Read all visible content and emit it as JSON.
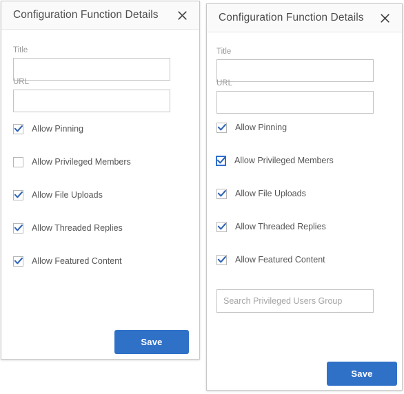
{
  "background_color": "#ffffff",
  "accent_color": "#3071c8",
  "panels": [
    {
      "id": "left",
      "header": {
        "title": "Configuration Function Details",
        "close_icon": "close-x-icon"
      },
      "fields": {
        "title": {
          "label": "Title",
          "value": "",
          "placeholder": ""
        },
        "url": {
          "label": "URL",
          "value": "",
          "placeholder": ""
        }
      },
      "checkboxes": [
        {
          "label": "Allow Pinning",
          "checked": true,
          "focused": false
        },
        {
          "label": "Allow Privileged Members",
          "checked": false,
          "focused": false
        },
        {
          "label": "Allow File Uploads",
          "checked": true,
          "focused": false
        },
        {
          "label": "Allow Threaded Replies",
          "checked": true,
          "focused": false
        },
        {
          "label": "Allow Featured Content",
          "checked": true,
          "focused": false
        }
      ],
      "search": null,
      "save_label": "Save"
    },
    {
      "id": "right",
      "header": {
        "title": "Configuration Function Details",
        "close_icon": "close-x-icon"
      },
      "fields": {
        "title": {
          "label": "Title",
          "value": "",
          "placeholder": ""
        },
        "url": {
          "label": "URL",
          "value": "",
          "placeholder": ""
        }
      },
      "checkboxes": [
        {
          "label": "Allow Pinning",
          "checked": true,
          "focused": false
        },
        {
          "label": "Allow Privileged Members",
          "checked": true,
          "focused": true
        },
        {
          "label": "Allow File Uploads",
          "checked": true,
          "focused": false
        },
        {
          "label": "Allow Threaded Replies",
          "checked": true,
          "focused": false
        },
        {
          "label": "Allow Featured Content",
          "checked": true,
          "focused": false
        }
      ],
      "search": {
        "placeholder": "Search Privileged Users Group",
        "value": ""
      },
      "save_label": "Save"
    }
  ]
}
